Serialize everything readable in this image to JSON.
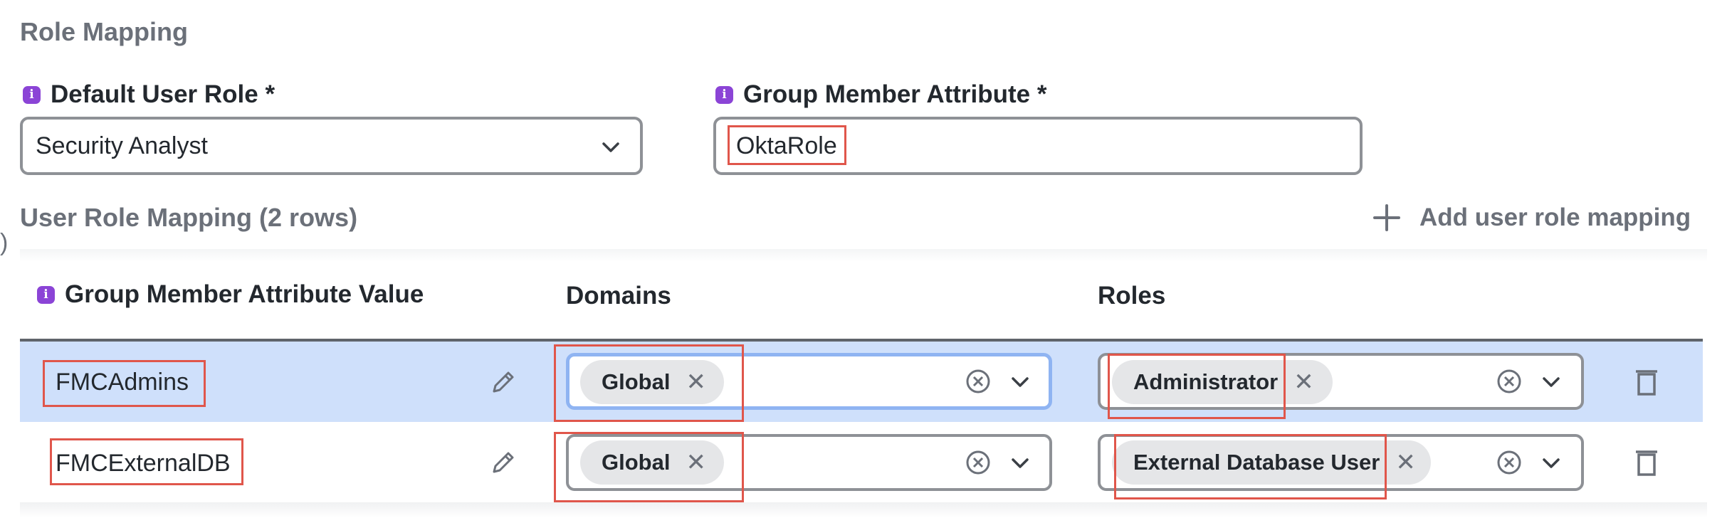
{
  "section": {
    "title": "Role Mapping"
  },
  "default_role": {
    "label": "Default User Role *",
    "value": "Security Analyst"
  },
  "group_attr": {
    "label": "Group Member Attribute *",
    "value": "OktaRole"
  },
  "mapping": {
    "title": "User Role Mapping (2 rows)",
    "add_label": "Add user role mapping",
    "headers": {
      "attr_value": "Group Member Attribute Value",
      "domains": "Domains",
      "roles": "Roles"
    },
    "rows": [
      {
        "attr_value": "FMCAdmins",
        "domain": "Global",
        "role": "Administrator",
        "selected": true
      },
      {
        "attr_value": "FMCExternalDB",
        "domain": "Global",
        "role": "External Database User",
        "selected": false
      }
    ]
  },
  "colors": {
    "accent_purple": "#8b44d6",
    "selected_row": "#cfe0fb",
    "focus_border": "#8fb4f2",
    "annotation_red": "#e0564b"
  },
  "icons": {
    "info": "info-icon",
    "dropdown": "chevron-down-icon",
    "add": "plus-icon",
    "edit": "pencil-icon",
    "clear": "clear-circle-icon",
    "remove_chip": "close-icon",
    "delete": "trash-icon"
  },
  "misc": {
    "edge_glyph": ")"
  }
}
